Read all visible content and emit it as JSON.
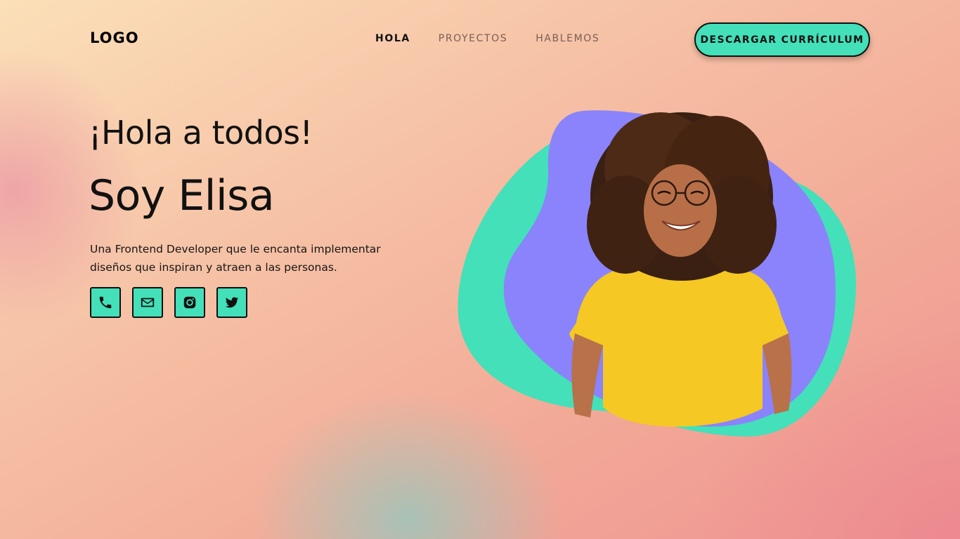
{
  "header": {
    "logo": "LOGO",
    "nav": [
      {
        "label": "HOLA",
        "active": true
      },
      {
        "label": "PROYECTOS",
        "active": false
      },
      {
        "label": "HABLEMOS",
        "active": false
      }
    ],
    "cta_label": "DESCARGAR CURRÍCULUM"
  },
  "hero": {
    "greeting": "¡Hola a todos!",
    "name": "Soy Elisa",
    "tagline": "Una Frontend Developer que le encanta implementar diseños que inspiran y atraen a las personas.",
    "socials": [
      {
        "icon": "phone-icon"
      },
      {
        "icon": "mail-icon"
      },
      {
        "icon": "instagram-icon"
      },
      {
        "icon": "twitter-icon"
      }
    ],
    "portrait": {
      "description_icon": "person-portrait",
      "blob_colors": {
        "back": "#43e0b9",
        "front": "#8a83fb"
      },
      "shirt_color": "#f5c824"
    }
  },
  "colors": {
    "accent": "#43e0b9",
    "purple_blob": "#8a83fb",
    "text": "#111111"
  }
}
